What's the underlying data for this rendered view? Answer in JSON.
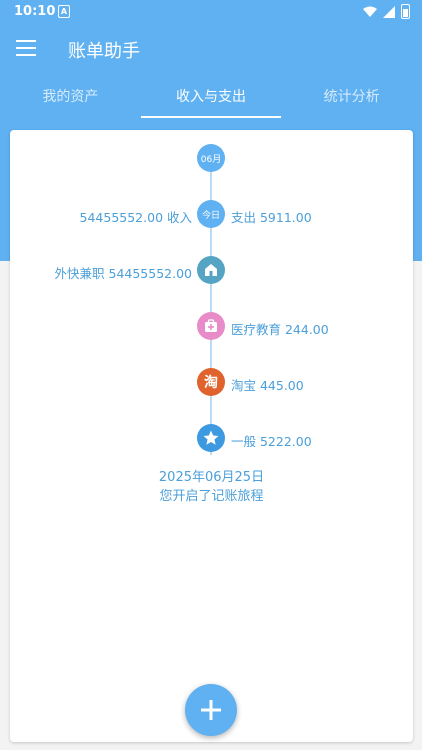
{
  "status_bar": {
    "time": "10:10",
    "notification_badge": "A"
  },
  "app": {
    "title": "账单助手"
  },
  "tabs": [
    {
      "label": "我的资产",
      "active": false
    },
    {
      "label": "收入与支出",
      "active": true
    },
    {
      "label": "统计分析",
      "active": false
    }
  ],
  "timeline": {
    "month": "06月",
    "summary": {
      "node": "今日",
      "income": "54455552.00 收入",
      "expense": "支出 5911.00"
    },
    "entries": [
      {
        "side": "left",
        "label": "外快兼职 54455552.00",
        "icon": "house-icon",
        "color": "#56a4c4"
      },
      {
        "side": "right",
        "label": "医疗教育 244.00",
        "icon": "medical-kit-icon",
        "color": "#e78cc9"
      },
      {
        "side": "right",
        "label": "淘宝 445.00",
        "icon": "taobao-icon",
        "icon_text": "淘",
        "color": "#e0622c"
      },
      {
        "side": "right",
        "label": "一般 5222.00",
        "icon": "star-icon",
        "color": "#3d9ae0"
      }
    ],
    "start": {
      "date": "2025年06月25日",
      "text": "您开启了记账旅程"
    }
  },
  "colors": {
    "primary": "#5fb1f2",
    "text_accent": "#4b9fda",
    "timeline_line": "#b7dcf7"
  }
}
